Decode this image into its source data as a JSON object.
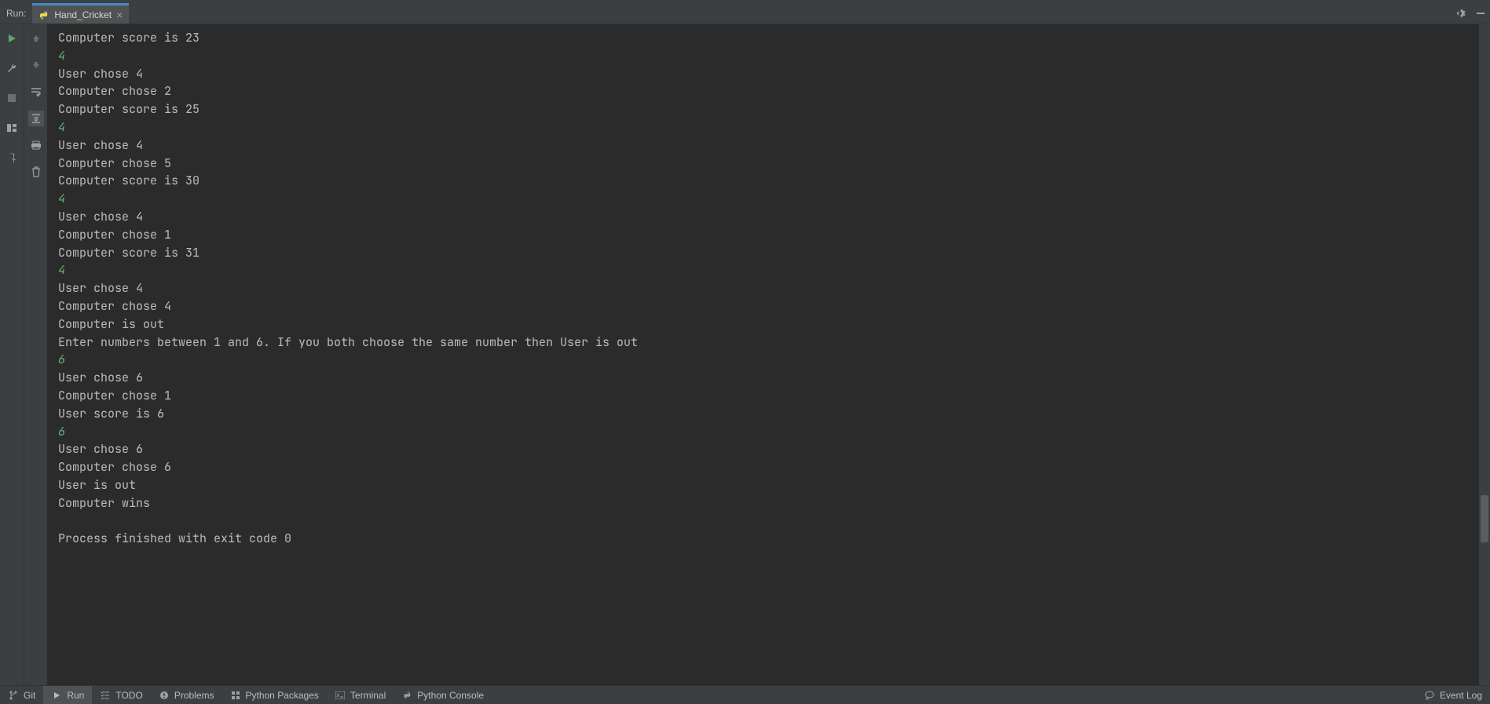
{
  "header": {
    "run_label": "Run:",
    "tab_name": "Hand_Cricket"
  },
  "console": {
    "lines": [
      {
        "c": "o",
        "t": "Computer score is 23"
      },
      {
        "c": "i",
        "t": "4"
      },
      {
        "c": "o",
        "t": "User chose 4"
      },
      {
        "c": "o",
        "t": "Computer chose 2"
      },
      {
        "c": "o",
        "t": "Computer score is 25"
      },
      {
        "c": "i",
        "t": "4"
      },
      {
        "c": "o",
        "t": "User chose 4"
      },
      {
        "c": "o",
        "t": "Computer chose 5"
      },
      {
        "c": "o",
        "t": "Computer score is 30"
      },
      {
        "c": "i",
        "t": "4"
      },
      {
        "c": "o",
        "t": "User chose 4"
      },
      {
        "c": "o",
        "t": "Computer chose 1"
      },
      {
        "c": "o",
        "t": "Computer score is 31"
      },
      {
        "c": "i",
        "t": "4"
      },
      {
        "c": "o",
        "t": "User chose 4"
      },
      {
        "c": "o",
        "t": "Computer chose 4"
      },
      {
        "c": "o",
        "t": "Computer is out"
      },
      {
        "c": "o",
        "t": "Enter numbers between 1 and 6. If you both choose the same number then User is out"
      },
      {
        "c": "i",
        "t": "6"
      },
      {
        "c": "o",
        "t": "User chose 6"
      },
      {
        "c": "o",
        "t": "Computer chose 1"
      },
      {
        "c": "o",
        "t": "User score is 6"
      },
      {
        "c": "i",
        "t": "6"
      },
      {
        "c": "o",
        "t": "User chose 6"
      },
      {
        "c": "o",
        "t": "Computer chose 6"
      },
      {
        "c": "o",
        "t": "User is out"
      },
      {
        "c": "o",
        "t": "Computer wins"
      },
      {
        "c": "o",
        "t": ""
      },
      {
        "c": "o",
        "t": "Process finished with exit code 0"
      }
    ]
  },
  "bottom": {
    "git": "Git",
    "run": "Run",
    "todo": "TODO",
    "problems": "Problems",
    "python_packages": "Python Packages",
    "terminal": "Terminal",
    "python_console": "Python Console",
    "event_log": "Event Log"
  }
}
